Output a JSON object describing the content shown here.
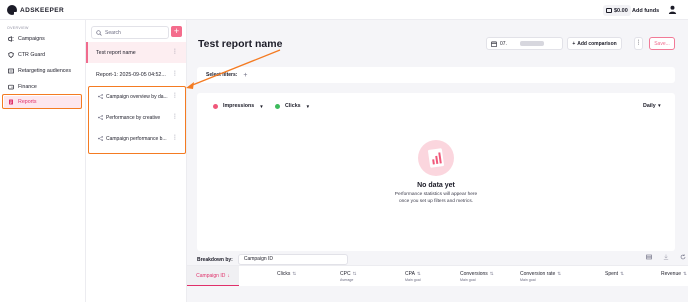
{
  "topbar": {
    "logo": "ADSKEEPER",
    "balance": "$0.00",
    "add_funds": "Add funds",
    "icons": [
      "wallet-icon",
      "user-icon"
    ]
  },
  "sidebar": {
    "caption": "OVERVIEW",
    "items": [
      {
        "label": "Campaigns",
        "icon": "megaphone-icon"
      },
      {
        "label": "CTR Guard",
        "icon": "shield-icon"
      },
      {
        "label": "Retargeting audiences",
        "icon": "target-icon"
      },
      {
        "label": "Finance",
        "icon": "wallet-icon"
      },
      {
        "label": "Reports",
        "icon": "report-icon",
        "active": true
      }
    ]
  },
  "reports_panel": {
    "search_placeholder": "Search",
    "add_button": "+",
    "reports": [
      {
        "label": "Test report name",
        "selected": true
      },
      {
        "label": "Report-1: 2025-09-05 04:52..."
      }
    ],
    "templates": [
      {
        "label": "Campaign overview by da..."
      },
      {
        "label": "Performance by creative"
      },
      {
        "label": "Campaign performance b..."
      }
    ]
  },
  "main": {
    "title": "Test report name",
    "date_prefix": "07.",
    "add_comparison": "Add comparison",
    "more": "⋮",
    "save": "Save...",
    "filters_label": "Select filters:",
    "metrics": [
      {
        "label": "Impressions",
        "color": "#f0587a"
      },
      {
        "label": "Clicks",
        "color": "#3dbb5c"
      }
    ],
    "granularity": "Daily",
    "empty_title": "No data yet",
    "empty_line1": "Performance statistics will appear here",
    "empty_line2": "once you set up filters and metrics.",
    "breakdown_label": "Breakdown by:",
    "breakdown_value": "Campaign ID",
    "columns": [
      {
        "label": "Campaign ID",
        "sub": ""
      },
      {
        "label": "Clicks",
        "sub": ""
      },
      {
        "label": "CPC",
        "sub": "Average"
      },
      {
        "label": "CPA",
        "sub": "Main goal"
      },
      {
        "label": "Conversions",
        "sub": "Main goal"
      },
      {
        "label": "Conversion rate",
        "sub": "Main goal"
      },
      {
        "label": "Spent",
        "sub": ""
      },
      {
        "label": "Revenue",
        "sub": ""
      }
    ]
  },
  "colors": {
    "accent": "#e0306a",
    "accent_soft": "#fde7ee",
    "highlight": "#f47b22"
  }
}
